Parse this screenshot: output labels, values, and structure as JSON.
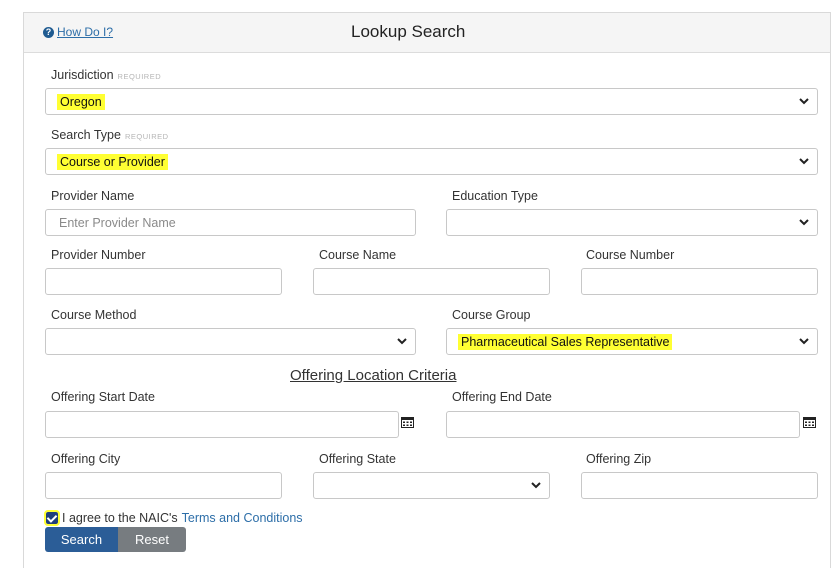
{
  "header": {
    "help_link": "How Do I?",
    "title": "Lookup Search"
  },
  "jurisdiction": {
    "label": "Jurisdiction",
    "required": "REQUIRED",
    "value": "Oregon"
  },
  "search_type": {
    "label": "Search Type",
    "required": "REQUIRED",
    "value": "Course or Provider"
  },
  "provider_name": {
    "label": "Provider Name",
    "placeholder": "Enter Provider Name",
    "value": ""
  },
  "education_type": {
    "label": "Education Type",
    "value": ""
  },
  "provider_number": {
    "label": "Provider Number",
    "value": ""
  },
  "course_name": {
    "label": "Course Name",
    "value": ""
  },
  "course_number": {
    "label": "Course Number",
    "value": ""
  },
  "course_method": {
    "label": "Course Method",
    "value": ""
  },
  "course_group": {
    "label": "Course Group",
    "value": "Pharmaceutical Sales Representative"
  },
  "section_title": "Offering Location Criteria",
  "offering_start_date": {
    "label": "Offering Start Date",
    "value": ""
  },
  "offering_end_date": {
    "label": "Offering End Date",
    "value": ""
  },
  "offering_city": {
    "label": "Offering City",
    "value": ""
  },
  "offering_state": {
    "label": "Offering State",
    "value": ""
  },
  "offering_zip": {
    "label": "Offering Zip",
    "value": ""
  },
  "agree": {
    "text": "I agree to the NAIC's",
    "link": "Terms and Conditions",
    "checked": true
  },
  "buttons": {
    "search": "Search",
    "reset": "Reset"
  },
  "colors": {
    "highlight": "#ffff33",
    "primary": "#2b5d97",
    "secondary": "#777c80",
    "link": "#2d6ea8"
  }
}
